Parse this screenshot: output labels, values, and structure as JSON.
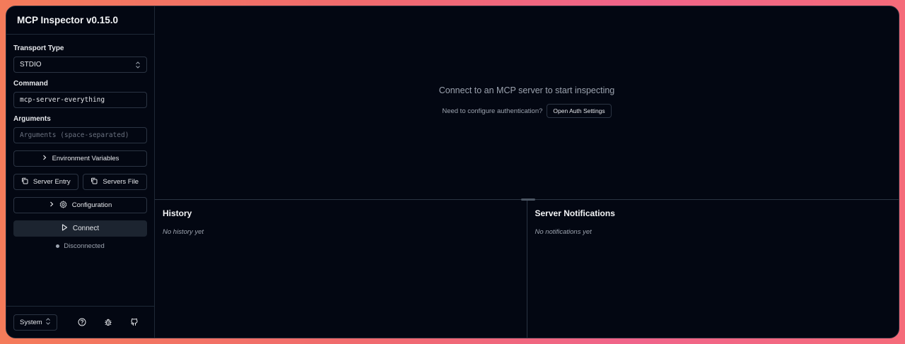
{
  "app": {
    "title": "MCP Inspector v0.15.0"
  },
  "sidebar": {
    "transport_label": "Transport Type",
    "transport_value": "STDIO",
    "command_label": "Command",
    "command_value": "mcp-server-everything",
    "arguments_label": "Arguments",
    "arguments_placeholder": "Arguments (space-separated)",
    "env_button": "Environment Variables",
    "server_entry_button": "Server Entry",
    "servers_file_button": "Servers File",
    "configuration_button": "Configuration",
    "connect_button": "Connect",
    "status_text": "Disconnected",
    "theme_value": "System",
    "icons": [
      "help-circle-icon",
      "bug-icon",
      "github-icon"
    ]
  },
  "main": {
    "message": "Connect to an MCP server to start inspecting",
    "auth_question": "Need to configure authentication?",
    "auth_button": "Open Auth Settings"
  },
  "history": {
    "title": "History",
    "empty": "No history yet"
  },
  "notifications": {
    "title": "Server Notifications",
    "empty": "No notifications yet"
  },
  "colors": {
    "background": "#030712",
    "border": "#1f2937",
    "text": "#e5e7eb",
    "muted": "#9ca3af",
    "connect_bg": "#1c2430"
  }
}
